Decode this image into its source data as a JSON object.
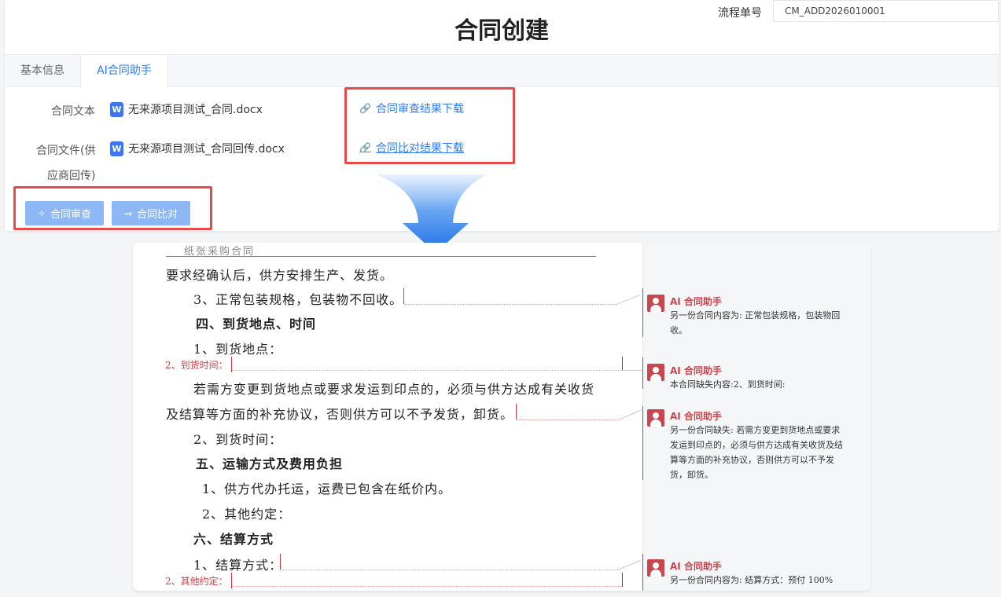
{
  "header": {
    "title": "合同创建",
    "flow_label": "流程单号",
    "flow_value": "CM_ADD2026010001"
  },
  "tabs": [
    {
      "label": "基本信息",
      "active": false
    },
    {
      "label": "AI合同助手",
      "active": true
    }
  ],
  "form": {
    "contract_text_label": "合同文本",
    "contract_text_file": "无来源项目测试_合同.docx",
    "return_file_label_line1": "合同文件(供",
    "return_file_label_line2": "应商回传)",
    "return_file": "无来源项目测试_合同回传.docx",
    "file_icon_letter": "W"
  },
  "links": {
    "review_download": "合同审查结果下载",
    "compare_download": "合同比对结果下载"
  },
  "buttons": {
    "review": "合同审查",
    "compare": "合同比对"
  },
  "document": {
    "header": "纸张采购合同",
    "lines": [
      "要求经确认后，供方安排生产、发货。",
      "3、正常包装规格，包装物不回收。",
      "四、到货地点、时间",
      "1、到货地点：",
      "若需方变更到货地点或要求发运到印点的，必须与供方达成有关收货",
      "及结算等方面的补充协议，否则供方可以不予发货，卸货。",
      "2、到货时间：",
      "五、运输方式及费用负担",
      "1、供方代办托运，运费已包含在纸价内。",
      "2、其他约定：",
      "六、结算方式",
      "1、结算方式："
    ],
    "insert_1": "2、到货时间：",
    "insert_2": "2、其他约定："
  },
  "comments": [
    {
      "author": "AI 合同助手",
      "text": "另一份合同内容为: 正常包装规格，包装物回收。"
    },
    {
      "author": "AI 合同助手",
      "text": "本合同缺失内容:2、到货时间:"
    },
    {
      "author": "AI 合同助手",
      "text": "另一份合同缺失: 若需方变更到货地点或要求发运到印点的，必须与供方达成有关收货及结算等方面的补充协议，否则供方可以不予发货，卸货。"
    },
    {
      "author": "AI 合同助手",
      "text": "另一份合同内容为: 结算方式：预付 100%"
    }
  ],
  "colors": {
    "primary": "#2f7cf6",
    "highlight_box": "#e84a4a",
    "button_bg": "#8db7f5",
    "comment_red": "#c9464e"
  }
}
